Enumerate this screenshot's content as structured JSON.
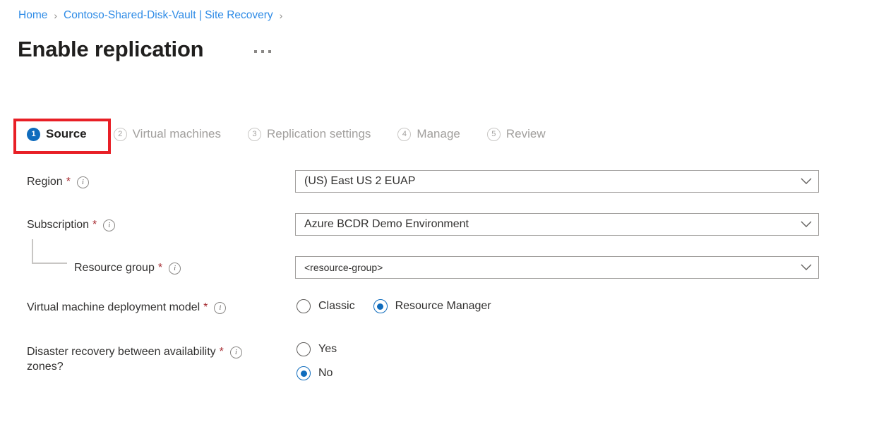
{
  "breadcrumb": {
    "items": [
      {
        "label": "Home"
      },
      {
        "label": "Contoso-Shared-Disk-Vault | Site Recovery"
      }
    ],
    "separator": "›"
  },
  "header": {
    "title": "Enable replication",
    "more_label": "…"
  },
  "wizard": {
    "tabs": [
      {
        "num": "1",
        "label": "Source",
        "state": "active"
      },
      {
        "num": "2",
        "label": "Virtual machines",
        "state": "inactive"
      },
      {
        "num": "3",
        "label": "Replication settings",
        "state": "inactive"
      },
      {
        "num": "4",
        "label": "Manage",
        "state": "inactive"
      },
      {
        "num": "5",
        "label": "Review",
        "state": "inactive"
      }
    ]
  },
  "form": {
    "region": {
      "label": "Region",
      "required": "*",
      "value": "(US) East US 2 EUAP"
    },
    "subscription": {
      "label": "Subscription",
      "required": "*",
      "value": "Azure BCDR Demo Environment"
    },
    "resource_group": {
      "label": "Resource group",
      "required": "*",
      "value": "<resource-group>"
    },
    "deployment_model": {
      "label": "Virtual machine deployment model",
      "required": "*",
      "options": [
        {
          "label": "Classic",
          "selected": false
        },
        {
          "label": "Resource Manager",
          "selected": true
        }
      ]
    },
    "availability_zones": {
      "label": "Disaster recovery between availability\nzones?",
      "required": "*",
      "options": [
        {
          "label": "Yes",
          "selected": false
        },
        {
          "label": "No",
          "selected": true
        }
      ]
    }
  },
  "colors": {
    "accent": "#0f6cbd",
    "link": "#2e8be6",
    "required": "#a4262c",
    "annotation": "#e81f26"
  }
}
